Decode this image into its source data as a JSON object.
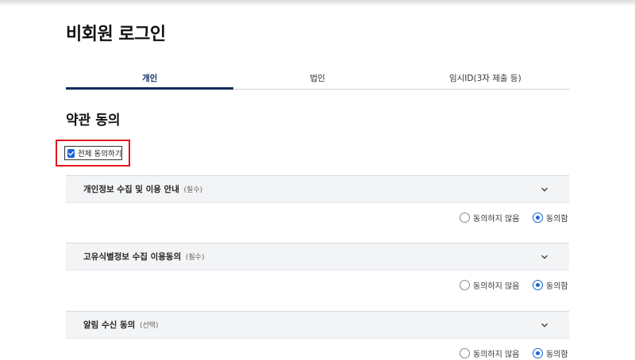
{
  "page": {
    "title": "비회원 로그인"
  },
  "tabs": [
    {
      "label": "개인",
      "active": true
    },
    {
      "label": "법인",
      "active": false
    },
    {
      "label": "임시ID(3자 제출 등)",
      "active": false
    }
  ],
  "terms_section": {
    "title": "약관 동의",
    "all_agree_label": "전체 동의하기",
    "all_agree_checked": true
  },
  "terms": [
    {
      "title": "개인정보 수집 및 이용 안내",
      "tag": "(필수)",
      "disagree_label": "동의하지 않음",
      "agree_label": "동의함",
      "selected": "agree"
    },
    {
      "title": "고유식별정보 수집 이용동의",
      "tag": "(필수)",
      "disagree_label": "동의하지 않음",
      "agree_label": "동의함",
      "selected": "agree"
    },
    {
      "title": "알림 수신 동의",
      "tag": "(선택)",
      "disagree_label": "동의하지 않음",
      "agree_label": "동의함",
      "selected": "agree"
    }
  ],
  "colors": {
    "accent": "#0f2a5e",
    "check_blue": "#1a66d6",
    "highlight_red": "#e0141c"
  },
  "icons": [
    "check-icon",
    "chevron-down-icon"
  ]
}
